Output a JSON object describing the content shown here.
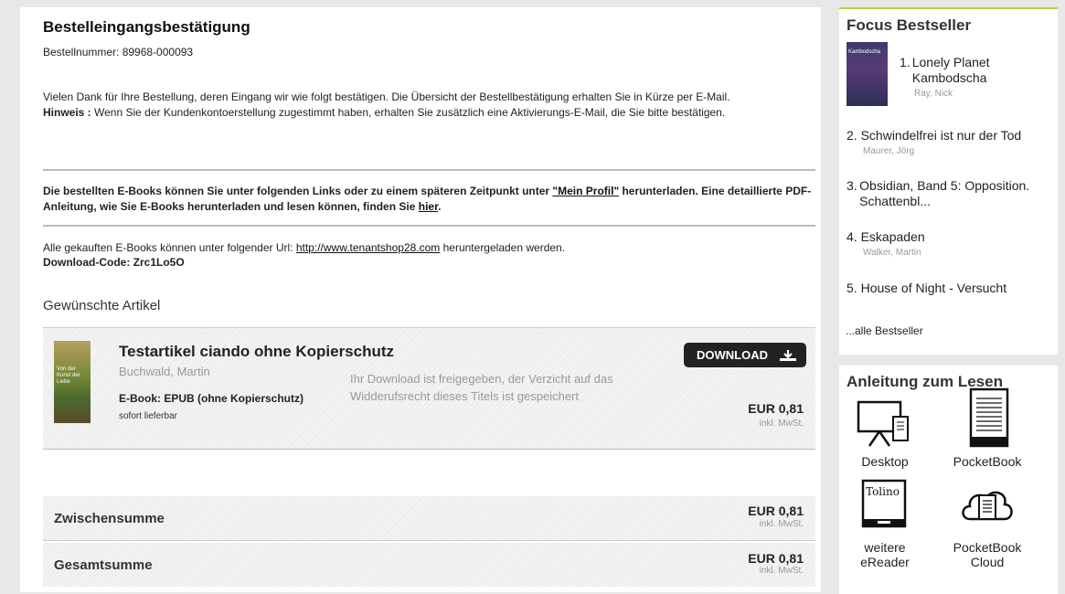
{
  "confirmation": {
    "title": "Bestelleingangsbestätigung",
    "order_number": "Bestellnummer: 89968-000093",
    "intro_text": "Vielen Dank für Ihre Bestellung, deren Eingang wir wie folgt bestätigen. Die Übersicht der Bestellbestätigung erhalten Sie in Kürze per E-Mail.",
    "hint_label": "Hinweis :",
    "hint_text": " Wenn Sie der Kundenkontoerstellung zugestimmt haben, erhalten Sie zusätzlich eine Aktivierungs-E-Mail, die Sie bitte bestätigen.",
    "links_text_1": "Die bestellten E-Books können Sie unter folgenden Links oder zu einem späteren Zeitpunkt unter ",
    "links_profile": "\"Mein Profil\"",
    "links_text_2": " herunterladen. Eine detaillierte PDF-Anleitung, wie Sie E-Books herunterladen und lesen können, finden Sie ",
    "links_here": "hier",
    "links_text_3": ".",
    "url_text_1": "Alle gekauften E-Books können unter folgender Url: ",
    "url_link": "http://www.tenantshop28.com",
    "url_text_2": " heruntergeladen werden.",
    "download_code": "Download-Code: Zrc1Lo5O",
    "wanted_heading": "Gewünschte Artikel"
  },
  "article": {
    "title": "Testartikel ciando ohne Kopierschutz",
    "author": "Buchwald, Martin",
    "format": "E-Book:  EPUB (ohne Kopierschutz)",
    "stock": "sofort lieferbar",
    "message": "Ihr Download ist freigegeben, der Verzicht auf das Widderufsrecht dieses Titels ist gespeichert",
    "download_label": "DOWNLOAD",
    "price": "EUR  0,81",
    "vat": "inkl. MwSt.",
    "cover_text": "Von der Kunst der Liebe"
  },
  "totals": {
    "subtotal_label": "Zwischensumme",
    "subtotal_price": "EUR 0,81",
    "subtotal_vat": "inkl. MwSt.",
    "total_label": "Gesamtsumme",
    "total_price": "EUR  0,81",
    "total_vat": "inkl. MwSt."
  },
  "bestsellers": {
    "title": "Focus Bestseller",
    "cover_text": "Kambodscha",
    "items": [
      {
        "num": "1.",
        "title": "Lonely Planet Kambodscha",
        "author": "Ray, Nick"
      },
      {
        "num": "2.",
        "title": "Schwindelfrei ist nur der Tod",
        "author": "Maurer, Jörg"
      },
      {
        "num": "3.",
        "title": "Obsidian, Band 5: Opposition. Schattenbl...",
        "author": ""
      },
      {
        "num": "4.",
        "title": "Eskapaden",
        "author": "Walker, Martin"
      },
      {
        "num": "5.",
        "title": "House of Night - Versucht",
        "author": ""
      }
    ],
    "all_link": "...alle Bestseller"
  },
  "guide": {
    "title": "Anleitung zum Lesen",
    "readers": [
      {
        "label": "Desktop",
        "icon": "desktop-icon"
      },
      {
        "label": "PocketBook",
        "icon": "ereader-icon"
      },
      {
        "label": "weitere eReader",
        "icon": "tolino-icon"
      },
      {
        "label": "PocketBook Cloud",
        "icon": "cloud-icon"
      }
    ],
    "tolino_text": "Tolino"
  },
  "colors": {
    "accent": "#c5cf3c",
    "button": "#222222",
    "page_bg": "#e8e8e8"
  }
}
